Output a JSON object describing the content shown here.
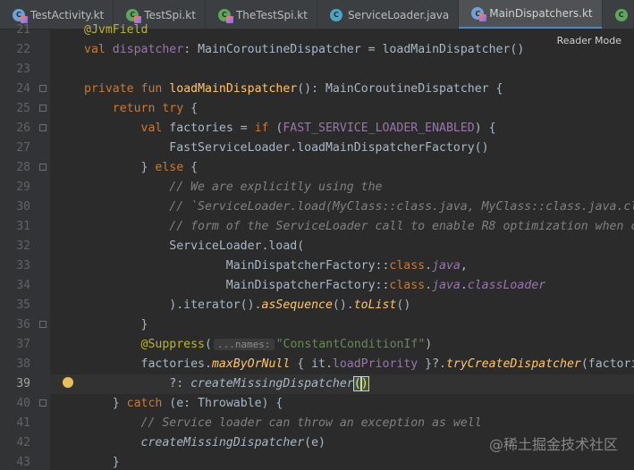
{
  "tabs": [
    {
      "label": "TestActivity.kt",
      "icon": "kotlin-file-icon"
    },
    {
      "label": "TestSpi.kt",
      "icon": "kotlin-file-icon"
    },
    {
      "label": "TheTestSpi.kt",
      "icon": "kotlin-file-icon"
    },
    {
      "label": "ServiceLoader.java",
      "icon": "java-file-icon"
    },
    {
      "label": "MainDispatchers.kt",
      "icon": "kotlin-file-icon",
      "active": true
    }
  ],
  "reader_mode": "Reader Mode",
  "line_numbers": [
    "21",
    "22",
    "23",
    "24",
    "25",
    "26",
    "27",
    "28",
    "29",
    "30",
    "31",
    "32",
    "33",
    "34",
    "35",
    "36",
    "37",
    "38",
    "39",
    "40",
    "41",
    "42",
    "43"
  ],
  "current_line": "39",
  "code": {
    "l21": "@JvmField",
    "l22_kw": "val",
    "l22_name": "dispatcher",
    "l22_rest": ": MainCoroutineDispatcher = loadMainDispatcher()",
    "l24_kw1": "private",
    "l24_kw2": "fun",
    "l24_fn": "loadMainDispatcher",
    "l24_rest": "(): MainCoroutineDispatcher {",
    "l25_kw": "return try",
    "l25_rest": " {",
    "l26_kw": "val",
    "l26_a": " factories = ",
    "l26_kw2": "if",
    "l26_b": " (",
    "l26_prop": "FAST_SERVICE_LOADER_ENABLED",
    "l26_c": ") {",
    "l27": "FastServiceLoader.loadMainDispatcherFactory()",
    "l28_a": "} ",
    "l28_kw": "else",
    "l28_b": " {",
    "l29": "// We are explicitly using the",
    "l30": "// `ServiceLoader.load(MyClass::class.java, MyClass::class.java.cla",
    "l31": "// form of the ServiceLoader call to enable R8 optimization when co",
    "l32": "ServiceLoader.load(",
    "l33_a": "MainDispatcherFactory::",
    "l33_kw": "class",
    "l33_b": ".",
    "l33_prop": "java",
    "l33_c": ",",
    "l34_a": "MainDispatcherFactory::",
    "l34_kw": "class",
    "l34_b": ".",
    "l34_prop": "java",
    "l34_c": ".",
    "l34_prop2": "classLoader",
    "l35_a": ").iterator().",
    "l35_ext1": "asSequence",
    "l35_b": "().",
    "l35_ext2": "toList",
    "l35_c": "()",
    "l36": "}",
    "l37_ann": "@Suppress",
    "l37_a": "(",
    "l37_hint": "...names:",
    "l37_str": "\"ConstantConditionIf\"",
    "l37_b": ")",
    "l38_a": "factories.",
    "l38_ext": "maxByOrNull",
    "l38_b": " { it.",
    "l38_prop": "loadPriority",
    "l38_c": " }?.",
    "l38_ext2": "tryCreateDispatcher",
    "l38_d": "(factorie",
    "l39_a": "?: ",
    "l39_fn": "createMissingDispatcher",
    "l39_p1": "(",
    "l39_p2": ")",
    "l40_a": "} ",
    "l40_kw": "catch",
    "l40_b": " (e: Throwable) {",
    "l41": "// Service loader can throw an exception as well",
    "l42_fn": "createMissingDispatcher",
    "l42_b": "(e)",
    "l43": "}"
  },
  "watermark": "@稀土掘金技术社区"
}
